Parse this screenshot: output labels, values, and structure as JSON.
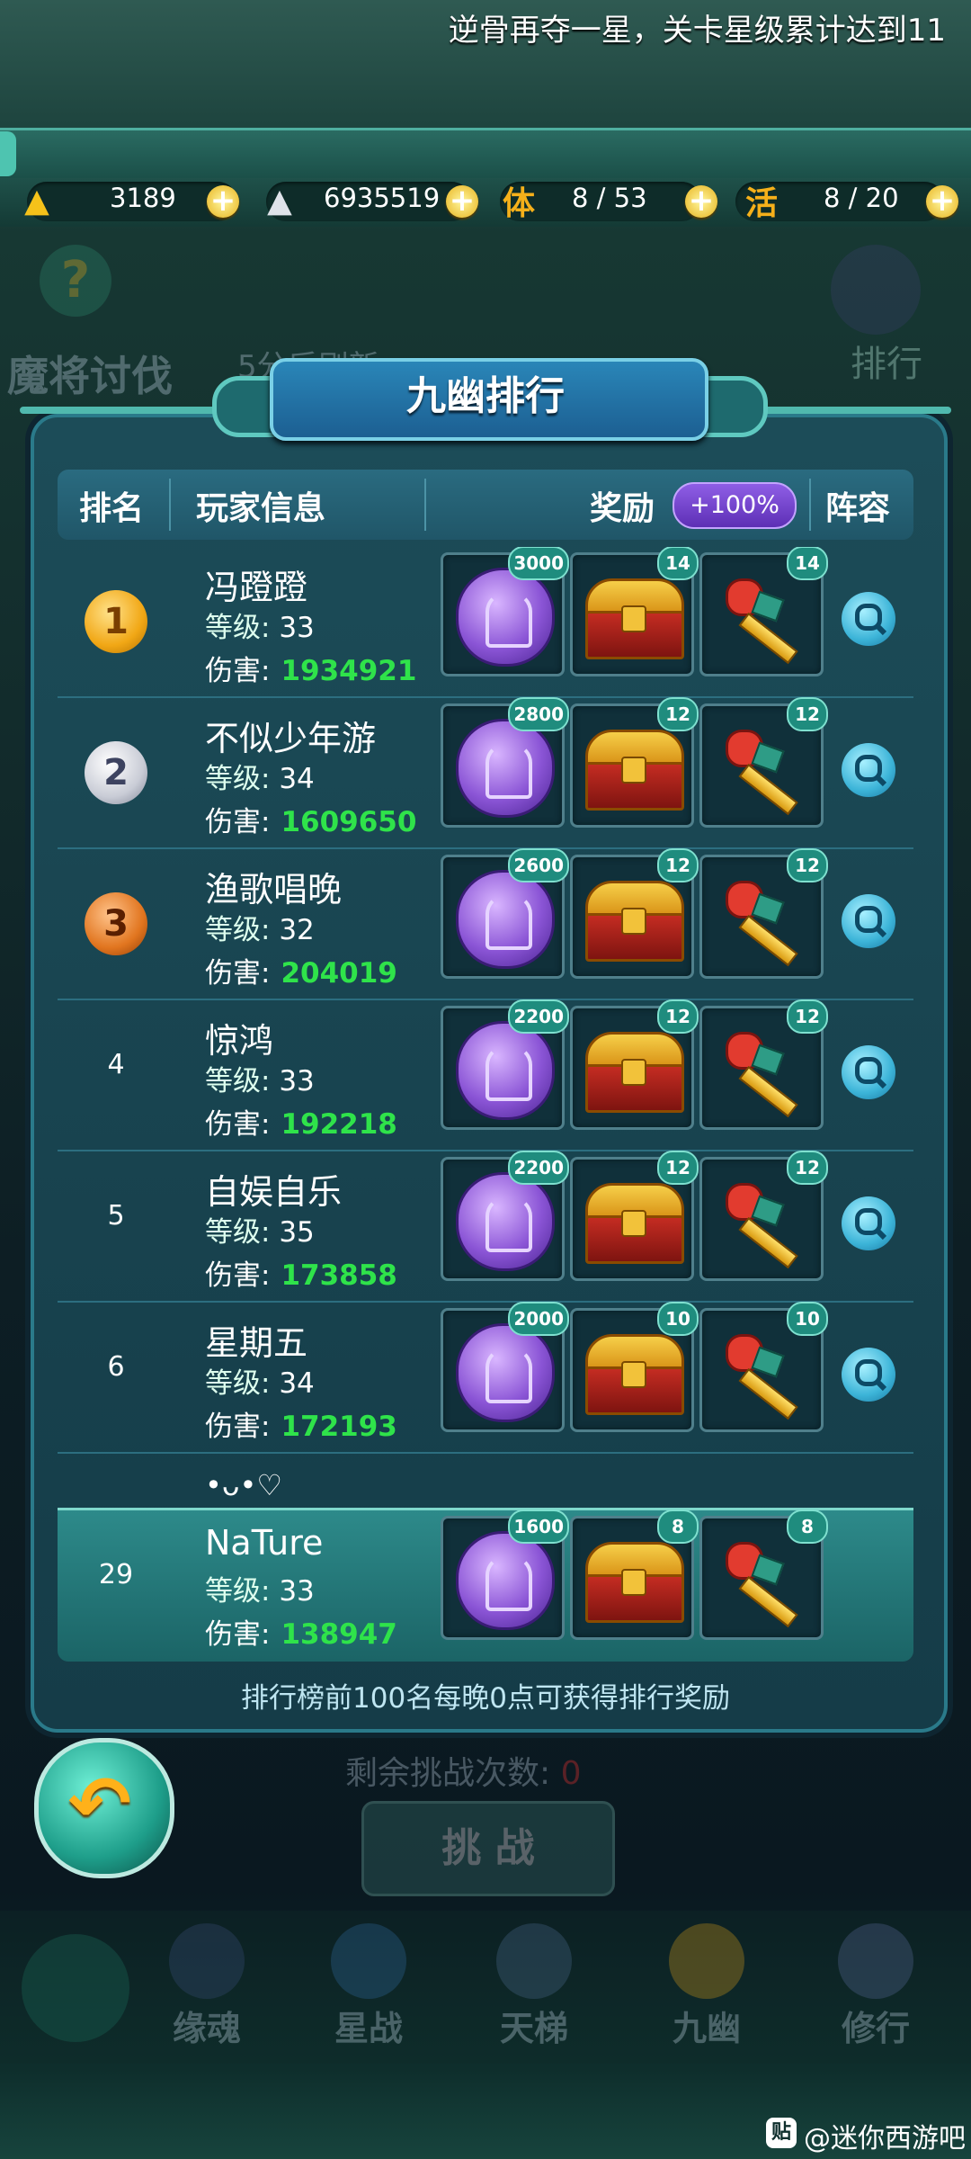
{
  "marquee": {
    "text": "逆骨再夺一星，关卡星级累计达到11"
  },
  "resources": {
    "gold": "3189",
    "silver": "6935519",
    "stamina_label": "体",
    "stamina": "8 / 53",
    "activity_label": "活",
    "activity": "8 / 20"
  },
  "background_ui": {
    "help": "?",
    "rank_label": "排行",
    "mode_title": "魔将讨伐",
    "refresh_text": "5分后刷新",
    "remaining_label": "剩余挑战次数:",
    "remaining_value": "0",
    "challenge_label": "挑 战",
    "nav": [
      "缘魂",
      "星战",
      "天梯",
      "九幽",
      "修行"
    ]
  },
  "panel": {
    "title": "九幽排行",
    "headers": {
      "rank": "排名",
      "player": "玩家信息",
      "reward": "奖励",
      "bonus": "+100%",
      "lineup": "阵容"
    },
    "level_label": "等级:",
    "damage_label": "伤害:",
    "rows": [
      {
        "rank": "1",
        "name": "冯蹬蹬",
        "level": "33",
        "damage": "1934921",
        "coin": "3000",
        "chest": "14",
        "key": "14"
      },
      {
        "rank": "2",
        "name": "不似少年游",
        "level": "34",
        "damage": "1609650",
        "coin": "2800",
        "chest": "12",
        "key": "12"
      },
      {
        "rank": "3",
        "name": "渔歌唱晚",
        "level": "32",
        "damage": "204019",
        "coin": "2600",
        "chest": "12",
        "key": "12"
      },
      {
        "rank": "4",
        "name": "惊鸿",
        "level": "33",
        "damage": "192218",
        "coin": "2200",
        "chest": "12",
        "key": "12"
      },
      {
        "rank": "5",
        "name": "自娱自乐",
        "level": "35",
        "damage": "173858",
        "coin": "2200",
        "chest": "12",
        "key": "12"
      },
      {
        "rank": "6",
        "name": "星期五",
        "level": "34",
        "damage": "172193",
        "coin": "2000",
        "chest": "10",
        "key": "10"
      }
    ],
    "partial_next_name": "•ᴗ•♡",
    "mine": {
      "rank": "29",
      "name": "NaTure",
      "level": "33",
      "damage": "138947",
      "coin": "1600",
      "chest": "8",
      "key": "8"
    },
    "footer": "排行榜前100名每晚0点可获得排行奖励"
  },
  "watermark": {
    "icon": "贴",
    "text": "@迷你西游吧"
  }
}
